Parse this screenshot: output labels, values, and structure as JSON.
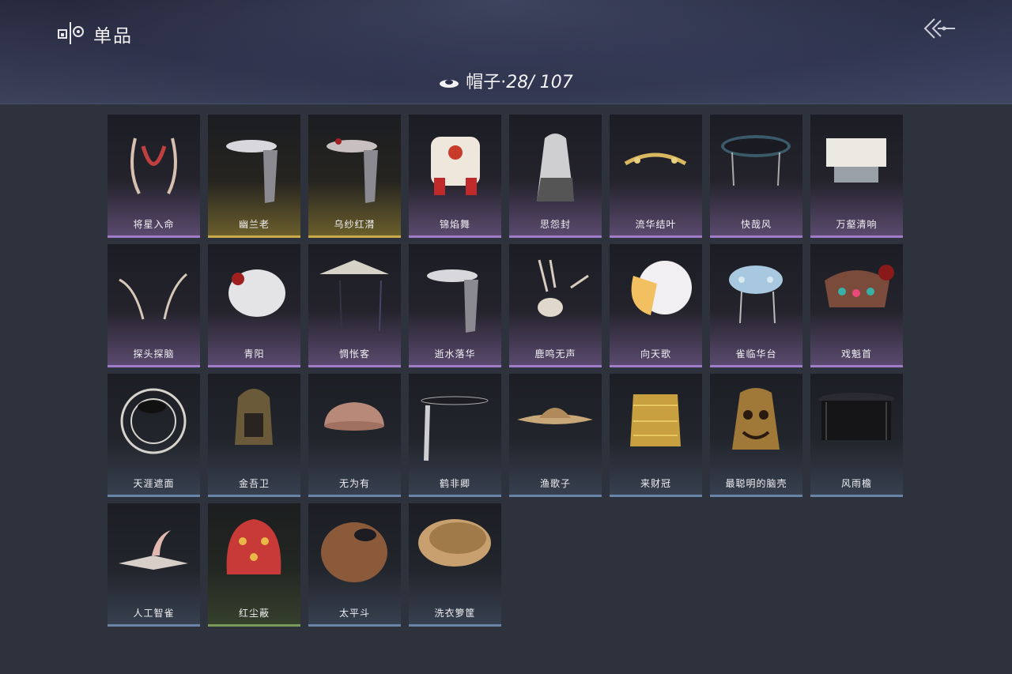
{
  "header": {
    "title": "单品",
    "category_label": "帽子·",
    "collected": "28",
    "total": "/ 107"
  },
  "items": [
    {
      "label": "将星入命",
      "rarity": "purple",
      "icon": "antler-horns-icon"
    },
    {
      "label": "幽兰老",
      "rarity": "gold",
      "icon": "veiled-hat-icon"
    },
    {
      "label": "乌纱红潸",
      "rarity": "gold",
      "icon": "veiled-hat-red-icon"
    },
    {
      "label": "锦焰舞",
      "rarity": "purple",
      "icon": "lion-dance-head-icon"
    },
    {
      "label": "思怨封",
      "rarity": "purple",
      "icon": "hooded-cloak-icon"
    },
    {
      "label": "流华结叶",
      "rarity": "purple",
      "icon": "laurel-crown-icon"
    },
    {
      "label": "快哉风",
      "rarity": "purple",
      "icon": "wide-brim-hat-icon"
    },
    {
      "label": "万壑清响",
      "rarity": "purple",
      "icon": "square-crown-icon"
    },
    {
      "label": "探头探脑",
      "rarity": "purple",
      "icon": "feather-pair-icon"
    },
    {
      "label": "青阳",
      "rarity": "purple",
      "icon": "white-cap-icon"
    },
    {
      "label": "惆怅客",
      "rarity": "purple",
      "icon": "bamboo-hat-icon"
    },
    {
      "label": "逝水落华",
      "rarity": "purple",
      "icon": "veiled-hat-icon"
    },
    {
      "label": "鹿鸣无声",
      "rarity": "purple",
      "icon": "deer-skull-icon"
    },
    {
      "label": "向天歌",
      "rarity": "purple",
      "icon": "duck-hood-icon"
    },
    {
      "label": "雀临华台",
      "rarity": "purple",
      "icon": "phoenix-crown-icon"
    },
    {
      "label": "戏魁首",
      "rarity": "purple",
      "icon": "opera-headdress-icon"
    },
    {
      "label": "天涯遮面",
      "rarity": "blue",
      "icon": "round-frame-hat-icon"
    },
    {
      "label": "金吾卫",
      "rarity": "blue",
      "icon": "helmet-icon"
    },
    {
      "label": "无为有",
      "rarity": "blue",
      "icon": "bowl-hat-icon"
    },
    {
      "label": "鹤非卿",
      "rarity": "blue",
      "icon": "flat-hat-icon"
    },
    {
      "label": "渔歌子",
      "rarity": "blue",
      "icon": "straw-hat-icon"
    },
    {
      "label": "来财冠",
      "rarity": "blue",
      "icon": "gold-crown-icon"
    },
    {
      "label": "最聪明的脑壳",
      "rarity": "blue",
      "icon": "bell-mask-icon"
    },
    {
      "label": "风雨檐",
      "rarity": "blue",
      "icon": "curtain-hat-icon"
    },
    {
      "label": "人工智雀",
      "rarity": "blue",
      "icon": "bird-hat-icon"
    },
    {
      "label": "红尘蔽",
      "rarity": "green",
      "icon": "red-hood-icon"
    },
    {
      "label": "太平斗",
      "rarity": "blue",
      "icon": "woven-basket-icon"
    },
    {
      "label": "洗衣箩筐",
      "rarity": "blue",
      "icon": "woven-bowl-icon"
    }
  ]
}
